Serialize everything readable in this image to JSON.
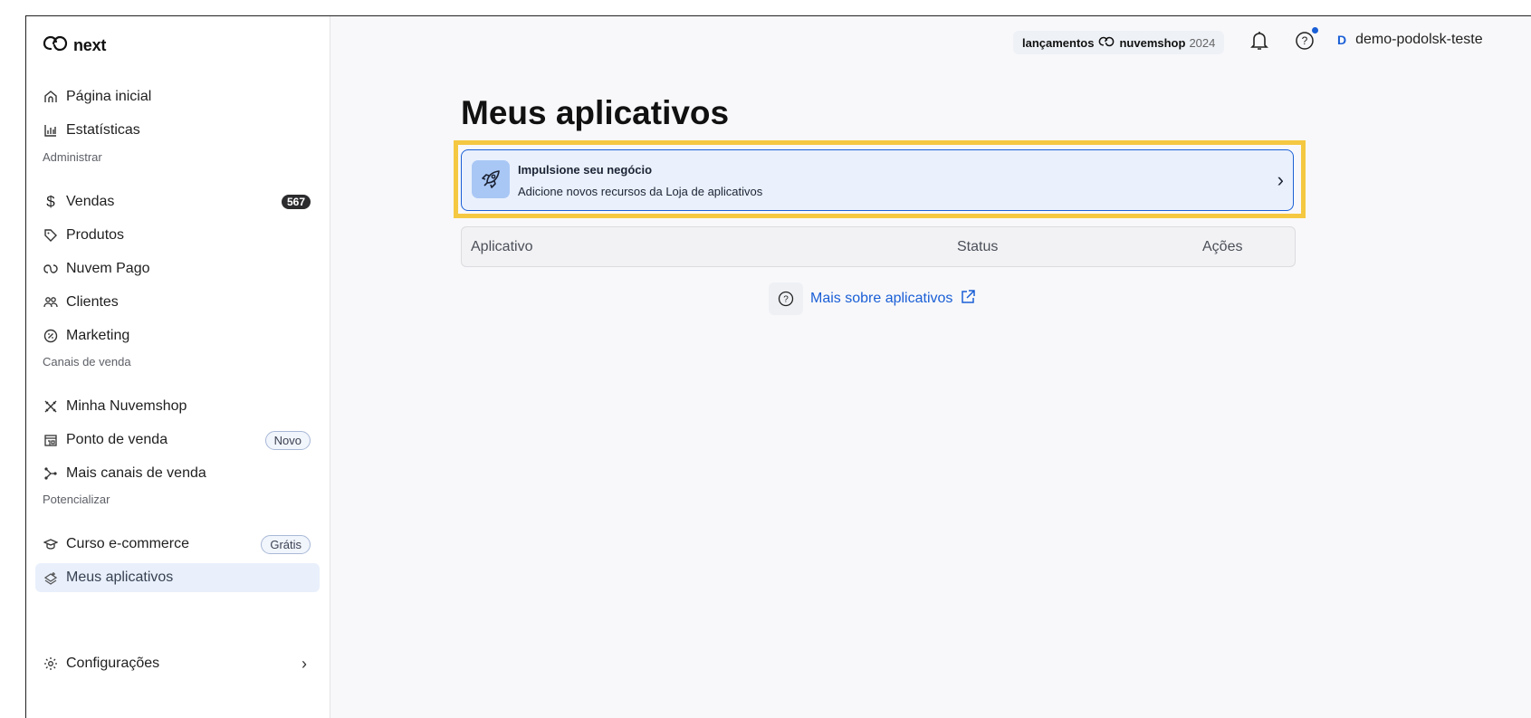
{
  "logo": {
    "text": "next"
  },
  "sidebar": {
    "top_items": [
      {
        "label": "Página inicial",
        "icon": "home-icon"
      },
      {
        "label": "Estatísticas",
        "icon": "bar-chart-icon"
      }
    ],
    "sections": [
      {
        "label": "Administrar",
        "items": [
          {
            "label": "Vendas",
            "icon": "dollar-icon",
            "badge": "567"
          },
          {
            "label": "Produtos",
            "icon": "tag-icon"
          },
          {
            "label": "Nuvem Pago",
            "icon": "cloud-icon"
          },
          {
            "label": "Clientes",
            "icon": "users-icon"
          },
          {
            "label": "Marketing",
            "icon": "percent-icon"
          }
        ]
      },
      {
        "label": "Canais de venda",
        "items": [
          {
            "label": "Minha Nuvemshop",
            "icon": "tools-icon"
          },
          {
            "label": "Ponto de venda",
            "icon": "store-icon",
            "badge": "Novo"
          },
          {
            "label": "Mais canais de venda",
            "icon": "channels-icon"
          }
        ]
      },
      {
        "label": "Potencializar",
        "items": [
          {
            "label": "Curso e-commerce",
            "icon": "graduation-cap-icon",
            "badge": "Grátis"
          },
          {
            "label": "Meus aplicativos",
            "icon": "apps-icon",
            "active": true
          }
        ]
      }
    ],
    "settings": {
      "label": "Configurações",
      "icon": "gear-icon"
    }
  },
  "header": {
    "launch": {
      "prefix": "lançamentos",
      "brand": "nuvemshop",
      "year": "2024"
    },
    "user": {
      "initial": "D",
      "name": "demo-podolsk-teste"
    }
  },
  "main": {
    "title": "Meus aplicativos",
    "promo": {
      "title": "Impulsione seu negócio",
      "subtitle": "Adicione novos recursos da Loja de aplicativos"
    },
    "table": {
      "columns": [
        "Aplicativo",
        "Status",
        "Ações"
      ]
    },
    "help_link": "Mais sobre aplicativos"
  },
  "colors": {
    "accent": "#1a5fd6",
    "highlight": "#f5c842",
    "active_bg": "#e9f0fc"
  }
}
